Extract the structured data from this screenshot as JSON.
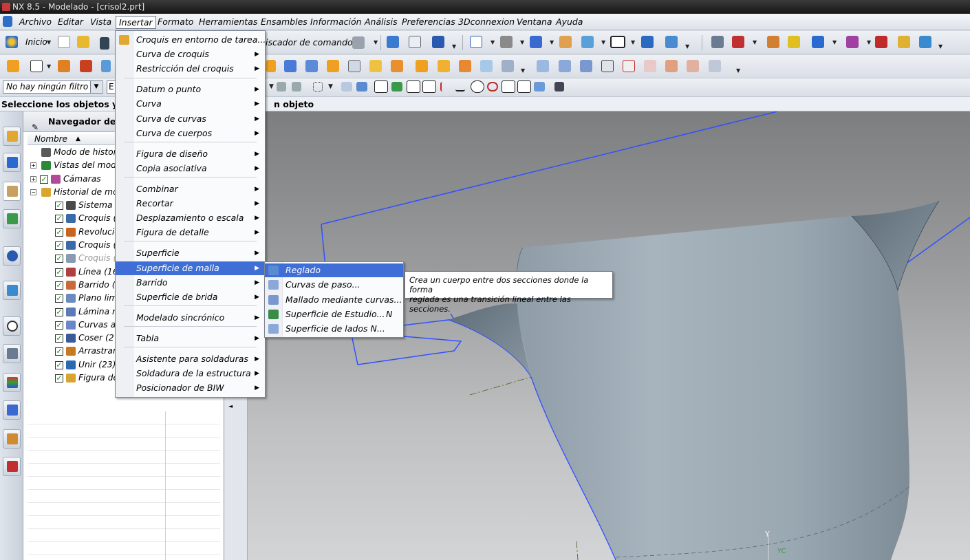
{
  "window": {
    "title": "NX 8.5 - Modelado - [crisol2.prt]"
  },
  "menubar": {
    "items": [
      "Archivo",
      "Editar",
      "Vista",
      "Insertar",
      "Formato",
      "Herramientas",
      "Ensambles",
      "Información",
      "Análisis",
      "Preferencias",
      "3Dconnexion",
      "Ventana",
      "Ayuda"
    ],
    "active": "Insertar"
  },
  "toolbar": {
    "inicio_label": "Inicio",
    "command_finder_label": "iscador de comandos"
  },
  "selection": {
    "filter_value": "No hay ningún filtro d",
    "scope_value": "E"
  },
  "status": {
    "prompt_left": "Seleccione los objetos y",
    "prompt_right": "n objeto"
  },
  "navigator": {
    "title": "Navegador de p",
    "column_name": "Nombre",
    "items": [
      {
        "label": "Modo de histori",
        "color": "#5a5a5a"
      },
      {
        "label": "Vistas del mode",
        "color": "#2a8a3a"
      },
      {
        "label": "Cámaras",
        "color": "#b24a9a"
      },
      {
        "label": "Historial de mo",
        "color": "#d9a430"
      },
      {
        "label": "Sistema d",
        "color": "#4a4a4a"
      },
      {
        "label": "Croquis (",
        "color": "#3a6aa8"
      },
      {
        "label": "Revolucio",
        "color": "#c8641e"
      },
      {
        "label": "Croquis (",
        "color": "#3a6aa8"
      },
      {
        "label": "Croquis (",
        "color": "#8a9ab0"
      },
      {
        "label": "Línea (16",
        "color": "#b04040"
      },
      {
        "label": "Barrido (",
        "color": "#c86a3a"
      },
      {
        "label": "Plano lim",
        "color": "#6a8ac0"
      },
      {
        "label": "Lámina r",
        "color": "#5a7ab8"
      },
      {
        "label": "Curvas a",
        "color": "#6a88c8"
      },
      {
        "label": "Coser (2",
        "color": "#3a5a9a"
      },
      {
        "label": "Arrastrar",
        "color": "#c8781e"
      },
      {
        "label": "Unir (23)",
        "color": "#2a6ab0"
      },
      {
        "label": "Figura de",
        "color": "#d9a430"
      }
    ]
  },
  "insert_menu": {
    "items": [
      {
        "label": "Croquis en entorno de tarea...",
        "submenu": false
      },
      {
        "label": "Curva de croquis",
        "submenu": true
      },
      {
        "label": "Restricción del croquis",
        "submenu": true
      },
      {
        "label": "Datum o punto",
        "submenu": true
      },
      {
        "label": "Curva",
        "submenu": true
      },
      {
        "label": "Curva de curvas",
        "submenu": true
      },
      {
        "label": "Curva de cuerpos",
        "submenu": true
      },
      {
        "label": "Figura de diseño",
        "submenu": true
      },
      {
        "label": "Copia asociativa",
        "submenu": true
      },
      {
        "label": "Combinar",
        "submenu": true
      },
      {
        "label": "Recortar",
        "submenu": true
      },
      {
        "label": "Desplazamiento o escala",
        "submenu": true
      },
      {
        "label": "Figura de detalle",
        "submenu": true
      },
      {
        "label": "Superficie",
        "submenu": true
      },
      {
        "label": "Superficie de malla",
        "submenu": true
      },
      {
        "label": "Barrido",
        "submenu": true
      },
      {
        "label": "Superficie de brida",
        "submenu": true
      },
      {
        "label": "Modelado sincrónico",
        "submenu": true
      },
      {
        "label": "Tabla",
        "submenu": true
      },
      {
        "label": "Asistente para soldaduras",
        "submenu": true
      },
      {
        "label": "Soldadura de la estructura",
        "submenu": true
      },
      {
        "label": "Posicionador de BIW",
        "submenu": true
      }
    ],
    "highlighted": "Superficie de malla"
  },
  "mesh_submenu": {
    "items": [
      {
        "label": "Reglado",
        "shortcut": ""
      },
      {
        "label": "Curvas de paso...",
        "shortcut": ""
      },
      {
        "label": "Mallado mediante curvas...",
        "shortcut": ""
      },
      {
        "label": "Superficie de Estudio...",
        "shortcut": "N"
      },
      {
        "label": "Superficie de lados N...",
        "shortcut": ""
      }
    ],
    "highlighted": "Reglado"
  },
  "tooltip": {
    "line1": "Crea un cuerpo entre dos secciones donde la forma",
    "line2": "reglada es una transición lineal entre las secciones."
  },
  "viewport": {
    "triad_y": "Y",
    "triad_yc": "YC"
  },
  "colors": {
    "highlight": "#3f6fd6",
    "tooltip_bg": "#ffffff",
    "sketch_line": "#3050ff"
  }
}
